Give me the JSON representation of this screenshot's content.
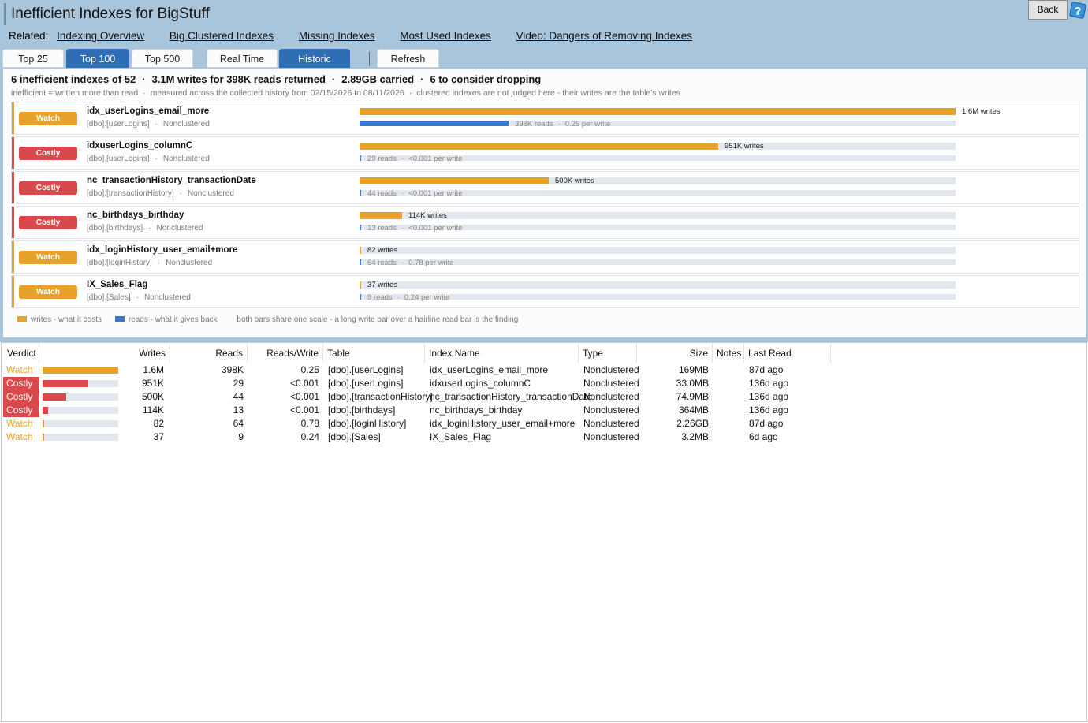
{
  "title": "Inefficient Indexes for BigStuff",
  "back_label": "Back",
  "related": {
    "label": "Related:",
    "links": [
      "Indexing Overview",
      "Big Clustered Indexes",
      "Missing Indexes",
      "Most Used Indexes",
      "Video: Dangers of Removing Indexes"
    ]
  },
  "tabs": [
    "Top 25",
    "Top 100",
    "Top 500",
    "Real Time",
    "Historic",
    "Refresh"
  ],
  "active_tabs": [
    "Top 100",
    "Historic"
  ],
  "summary": {
    "count": "6 inefficient indexes of 52",
    "traffic": "3.1M writes for 398K reads returned",
    "carried": "2.89GB carried",
    "drop": "6 to consider dropping"
  },
  "subnote": {
    "definition": "inefficient = written more than read",
    "window": "measured across the collected history from 02/15/2026 to 08/11/2026",
    "clustered": "clustered indexes are not judged here - their writes are the table's writes"
  },
  "colors": {
    "watch": "#e8a22c",
    "costly": "#d9484a",
    "reads": "#3a78c9",
    "track": "#e3e8ef"
  },
  "cards": [
    {
      "verdict": "Watch",
      "name": "idx_userLogins_email_more",
      "table": "[dbo].[userLogins]",
      "type": "Nonclustered",
      "writes_label": "1.6M writes",
      "writes_frac": 1.0,
      "reads_frac": 0.25,
      "reads_label": "398K reads",
      "ratio_label": "0.25 per write"
    },
    {
      "verdict": "Costly",
      "name": "idxuserLogins_columnC",
      "table": "[dbo].[userLogins]",
      "type": "Nonclustered",
      "writes_label": "951K writes",
      "writes_frac": 0.602,
      "reads_frac": 0.0,
      "reads_label": "29 reads",
      "ratio_label": "<0.001 per write"
    },
    {
      "verdict": "Costly",
      "name": "nc_transactionHistory_transactionDate",
      "table": "[dbo].[transactionHistory]",
      "type": "Nonclustered",
      "writes_label": "500K writes",
      "writes_frac": 0.317,
      "reads_frac": 0.0,
      "reads_label": "44 reads",
      "ratio_label": "<0.001 per write"
    },
    {
      "verdict": "Costly",
      "name": "nc_birthdays_birthday",
      "table": "[dbo].[birthdays]",
      "type": "Nonclustered",
      "writes_label": "114K writes",
      "writes_frac": 0.072,
      "reads_frac": 0.0,
      "reads_label": "13 reads",
      "ratio_label": "<0.001 per write"
    },
    {
      "verdict": "Watch",
      "name": "idx_loginHistory_user_email+more",
      "table": "[dbo].[loginHistory]",
      "type": "Nonclustered",
      "writes_label": "82 writes",
      "writes_frac": 0.0,
      "reads_frac": 0.0,
      "reads_label": "64 reads",
      "ratio_label": "0.78 per write"
    },
    {
      "verdict": "Watch",
      "name": "IX_Sales_Flag",
      "table": "[dbo].[Sales]",
      "type": "Nonclustered",
      "writes_label": "37 writes",
      "writes_frac": 0.0,
      "reads_frac": 0.0,
      "reads_label": "9 reads",
      "ratio_label": "0.24 per write"
    }
  ],
  "legend": {
    "writes": "writes - what it costs",
    "reads": "reads - what it gives back",
    "note": "both bars share one scale - a long write bar over a hairline read bar is the finding"
  },
  "grid": {
    "headers": [
      "Verdict",
      "Writes",
      "Reads",
      "Reads/Write",
      "Table",
      "Index Name",
      "Type",
      "Size",
      "Notes",
      "Last Read"
    ],
    "rows": [
      {
        "verdict": "Watch",
        "bar_frac": 1.0,
        "writes": "1.6M",
        "reads": "398K",
        "ratio": "0.25",
        "table": "[dbo].[userLogins]",
        "index": "idx_userLogins_email_more",
        "type": "Nonclustered",
        "size": "169MB",
        "notes": "",
        "last_read": "87d ago"
      },
      {
        "verdict": "Costly",
        "bar_frac": 0.602,
        "writes": "951K",
        "reads": "29",
        "ratio": "<0.001",
        "table": "[dbo].[userLogins]",
        "index": "idxuserLogins_columnC",
        "type": "Nonclustered",
        "size": "33.0MB",
        "notes": "",
        "last_read": "136d ago"
      },
      {
        "verdict": "Costly",
        "bar_frac": 0.317,
        "writes": "500K",
        "reads": "44",
        "ratio": "<0.001",
        "table": "[dbo].[transactionHistory]",
        "index": "nc_transactionHistory_transactionDate",
        "type": "Nonclustered",
        "size": "74.9MB",
        "notes": "",
        "last_read": "136d ago"
      },
      {
        "verdict": "Costly",
        "bar_frac": 0.072,
        "writes": "114K",
        "reads": "13",
        "ratio": "<0.001",
        "table": "[dbo].[birthdays]",
        "index": "nc_birthdays_birthday",
        "type": "Nonclustered",
        "size": "364MB",
        "notes": "",
        "last_read": "136d ago"
      },
      {
        "verdict": "Watch",
        "bar_frac": 0.0,
        "writes": "82",
        "reads": "64",
        "ratio": "0.78",
        "table": "[dbo].[loginHistory]",
        "index": "idx_loginHistory_user_email+more",
        "type": "Nonclustered",
        "size": "2.26GB",
        "notes": "",
        "last_read": "87d ago"
      },
      {
        "verdict": "Watch",
        "bar_frac": 0.0,
        "writes": "37",
        "reads": "9",
        "ratio": "0.24",
        "table": "[dbo].[Sales]",
        "index": "IX_Sales_Flag",
        "type": "Nonclustered",
        "size": "3.2MB",
        "notes": "",
        "last_read": "6d ago"
      }
    ]
  }
}
